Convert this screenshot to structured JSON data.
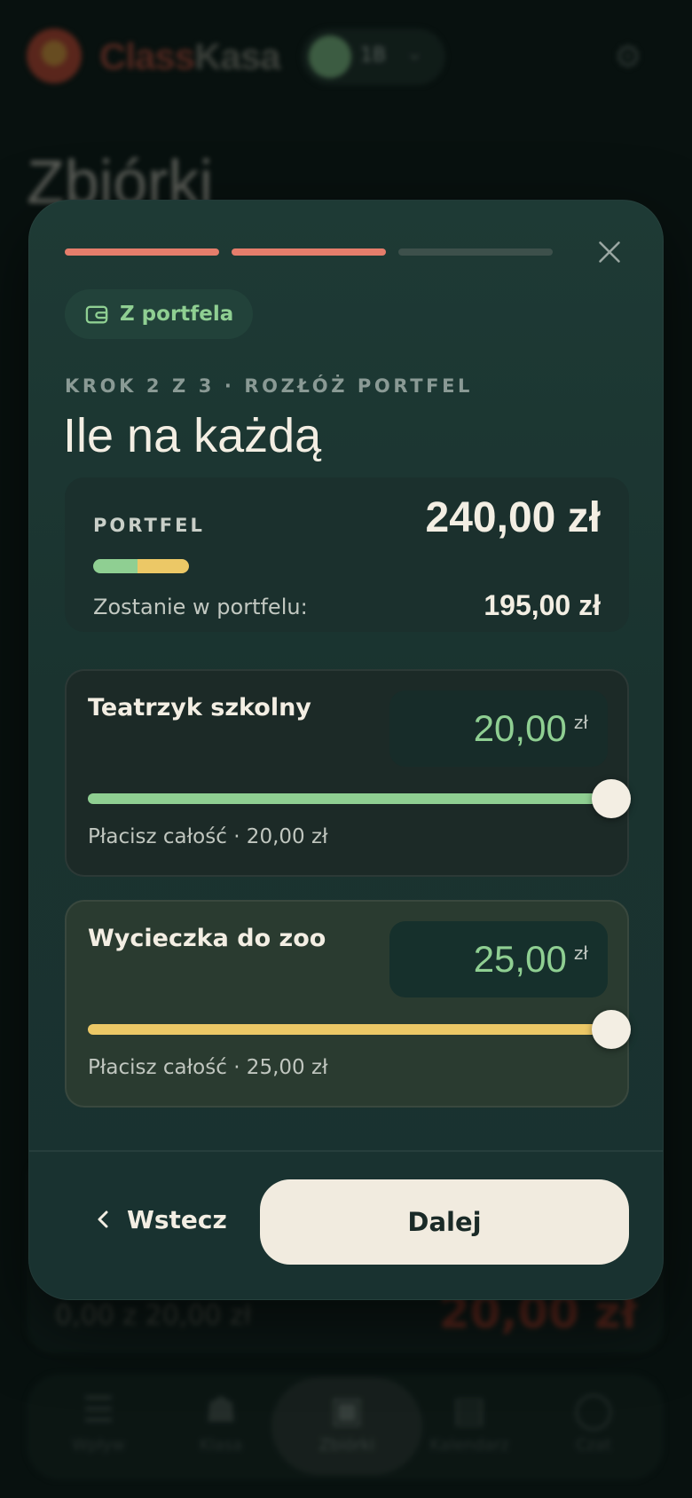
{
  "background": {
    "brand": {
      "part1": "Class",
      "part2": "Kasa"
    },
    "user_pill": {
      "initials": "1B",
      "chevron": "chevron-down-icon"
    },
    "settings_icon": "gear-icon",
    "page_title": "Zbiórki",
    "card": {
      "progress_text": "0,00 z 20,00 zł",
      "amount": "20,00 zł"
    },
    "nav": [
      {
        "label": "Wpływ",
        "icon": "list-icon"
      },
      {
        "label": "Klasa",
        "icon": "people-icon"
      },
      {
        "label": "Zbiórki",
        "icon": "wallet-icon"
      },
      {
        "label": "Kalendarz",
        "icon": "calendar-icon"
      },
      {
        "label": "Czat",
        "icon": "chat-icon"
      }
    ]
  },
  "modal": {
    "progress": {
      "total_steps": 3,
      "completed_steps": 2
    },
    "close_icon": "close-icon",
    "source_chip": {
      "icon": "wallet-icon",
      "label": "Z portfela"
    },
    "step_label": "KROK 2 Z 3 · ROZŁÓŻ PORTFEL",
    "headline": "Ile na każdą",
    "wallet": {
      "label": "PORTFEL",
      "total": "240,00 zł",
      "remain_label": "Zostanie w portfelu:",
      "remain_value": "195,00 zł",
      "usage_colors": [
        "#8fcf92",
        "#ecc866"
      ]
    },
    "allocations": [
      {
        "name": "Teatrzyk szkolny",
        "amount": "20,00",
        "currency": "zł",
        "slider_fraction": 1.0,
        "color": "#8fcf92",
        "note": "Płacisz całość · 20,00 zł"
      },
      {
        "name": "Wycieczka do zoo",
        "amount": "25,00",
        "currency": "zł",
        "slider_fraction": 1.0,
        "color": "#ecc866",
        "note": "Płacisz całość · 25,00 zł"
      }
    ],
    "footer": {
      "back_label": "Wstecz",
      "back_icon": "chevron-left-icon",
      "next_label": "Dalej"
    }
  },
  "colors": {
    "accent_coral": "#e57d6b",
    "accent_green": "#8fcf92",
    "accent_yellow": "#ecc866"
  }
}
